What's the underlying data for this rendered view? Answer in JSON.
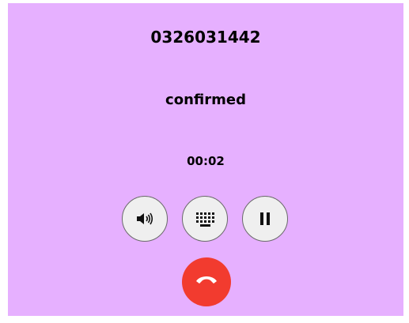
{
  "call": {
    "number": "0326031442",
    "status": "confirmed",
    "duration": "00:02"
  },
  "controls": {
    "speaker_icon": "speaker-icon",
    "keypad_icon": "dialpad-icon",
    "hold_icon": "pause-icon",
    "hangup_icon": "phone-hangup-icon"
  },
  "colors": {
    "background": "#e6b0ff",
    "hangup": "#f23b2f",
    "control_bg": "#efefef"
  }
}
